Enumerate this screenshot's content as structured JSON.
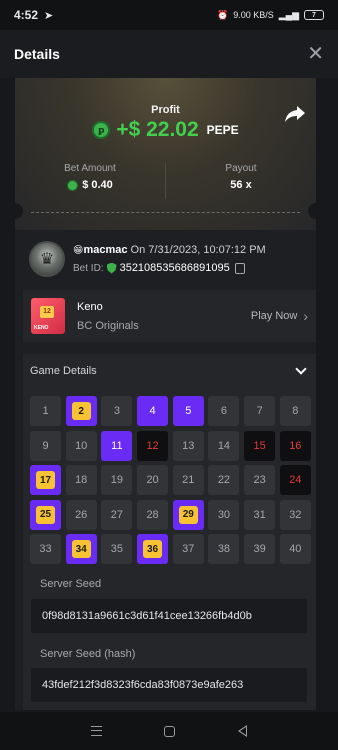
{
  "status_bar": {
    "time": "4:52",
    "network_speed": "9.00 KB/S",
    "battery": "7"
  },
  "header": {
    "title": "Details"
  },
  "profit": {
    "label": "Profit",
    "amount": "+$ 22.02",
    "currency": "PEPE"
  },
  "stats": {
    "bet_amount_label": "Bet Amount",
    "bet_amount_value": "$ 0.40",
    "payout_label": "Payout",
    "payout_value": "56 x"
  },
  "user": {
    "emoji": "😁",
    "name": "macmac",
    "date_text": "On 7/31/2023, 10:07:12 PM",
    "bet_id_label": "Bet ID:",
    "bet_id": "352108535686891095"
  },
  "game": {
    "thumb_label": "KENO",
    "name": "Keno",
    "subtitle": "BC Originals",
    "play_label": "Play Now"
  },
  "details": {
    "title": "Game Details",
    "cells": [
      {
        "n": "1",
        "s": "idle"
      },
      {
        "n": "2",
        "s": "hit"
      },
      {
        "n": "3",
        "s": "idle"
      },
      {
        "n": "4",
        "s": "sel"
      },
      {
        "n": "5",
        "s": "sel"
      },
      {
        "n": "6",
        "s": "idle"
      },
      {
        "n": "7",
        "s": "idle"
      },
      {
        "n": "8",
        "s": "idle"
      },
      {
        "n": "9",
        "s": "idle"
      },
      {
        "n": "10",
        "s": "idle"
      },
      {
        "n": "11",
        "s": "sel"
      },
      {
        "n": "12",
        "s": "miss"
      },
      {
        "n": "13",
        "s": "idle"
      },
      {
        "n": "14",
        "s": "idle"
      },
      {
        "n": "15",
        "s": "miss"
      },
      {
        "n": "16",
        "s": "miss"
      },
      {
        "n": "17",
        "s": "hit"
      },
      {
        "n": "18",
        "s": "idle"
      },
      {
        "n": "19",
        "s": "idle"
      },
      {
        "n": "20",
        "s": "idle"
      },
      {
        "n": "21",
        "s": "idle"
      },
      {
        "n": "22",
        "s": "idle"
      },
      {
        "n": "23",
        "s": "idle"
      },
      {
        "n": "24",
        "s": "miss"
      },
      {
        "n": "25",
        "s": "hit"
      },
      {
        "n": "26",
        "s": "idle"
      },
      {
        "n": "27",
        "s": "idle"
      },
      {
        "n": "28",
        "s": "idle"
      },
      {
        "n": "29",
        "s": "hit"
      },
      {
        "n": "30",
        "s": "idle"
      },
      {
        "n": "31",
        "s": "idle"
      },
      {
        "n": "32",
        "s": "idle"
      },
      {
        "n": "33",
        "s": "idle"
      },
      {
        "n": "34",
        "s": "hit"
      },
      {
        "n": "35",
        "s": "idle"
      },
      {
        "n": "36",
        "s": "hit"
      },
      {
        "n": "37",
        "s": "idle"
      },
      {
        "n": "38",
        "s": "idle"
      },
      {
        "n": "39",
        "s": "idle"
      },
      {
        "n": "40",
        "s": "idle"
      }
    ],
    "server_seed_label": "Server Seed",
    "server_seed": "0f98d8131a9661c3d61f41cee13266fb4d0b",
    "server_seed_hash_label": "Server Seed (hash)",
    "server_seed_hash": "43fdef212f3d8323f6cda83f0873e9afe263"
  },
  "colors": {
    "profit_green": "#42d04c",
    "selected_purple": "#6a2cf4",
    "hit_gold": "#f7c333",
    "miss_red": "#e23b3b"
  }
}
